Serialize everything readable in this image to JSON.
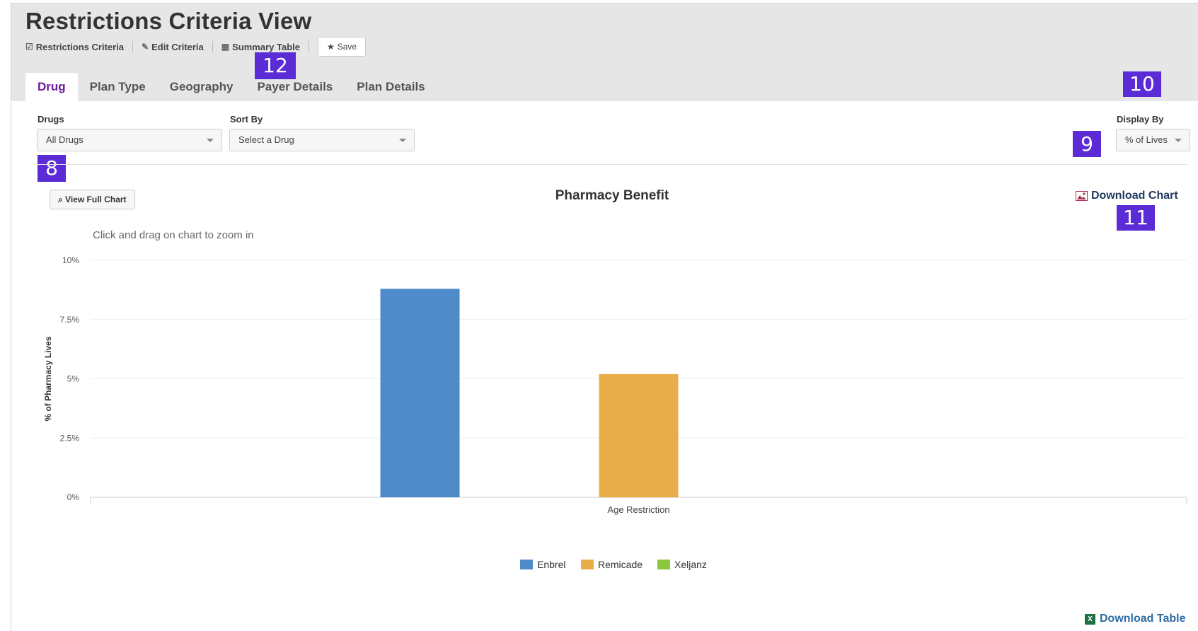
{
  "page_title": "Restrictions Criteria View",
  "toolbar": {
    "restrictions_criteria": "Restrictions Criteria",
    "edit_criteria": "Edit Criteria",
    "summary_table": "Summary Table",
    "save": "Save"
  },
  "tabs": [
    {
      "label": "Drug",
      "active": true
    },
    {
      "label": "Plan Type",
      "active": false
    },
    {
      "label": "Geography",
      "active": false
    },
    {
      "label": "Payer Details",
      "active": false
    },
    {
      "label": "Plan Details",
      "active": false
    }
  ],
  "filters": {
    "drugs": {
      "label": "Drugs",
      "value": "All Drugs"
    },
    "sort_by": {
      "label": "Sort By",
      "value": "Select a Drug"
    },
    "display_by": {
      "label": "Display By",
      "value": "% of Lives"
    }
  },
  "badges": {
    "b8": "8",
    "b9": "9",
    "b10": "10",
    "b11": "11",
    "b12": "12"
  },
  "view_full_chart": "View Full Chart",
  "download_chart": "Download Chart",
  "download_table": "Download Table",
  "zoom_hint": "Click and drag on chart to zoom in",
  "colors": {
    "accent": "#6a1b9a",
    "badge": "#5b2bd6",
    "enbrel": "#4f8ac9",
    "remicade": "#e8ad49",
    "xeljanz": "#8cc63f"
  },
  "chart_data": {
    "type": "bar",
    "title": "Pharmacy Benefit",
    "xlabel": "",
    "ylabel": "% of Pharmacy Lives",
    "categories": [
      "Age Restriction"
    ],
    "ylim": [
      0,
      10
    ],
    "yticks": [
      "0%",
      "2.5%",
      "5%",
      "7.5%",
      "10%"
    ],
    "ytick_values": [
      0,
      2.5,
      5,
      7.5,
      10
    ],
    "grid": true,
    "legend_position": "bottom",
    "series": [
      {
        "name": "Enbrel",
        "values": [
          8.8
        ],
        "color": "#4f8ac9"
      },
      {
        "name": "Remicade",
        "values": [
          5.2
        ],
        "color": "#e8ad49"
      },
      {
        "name": "Xeljanz",
        "values": [
          0
        ],
        "color": "#8cc63f"
      }
    ]
  }
}
